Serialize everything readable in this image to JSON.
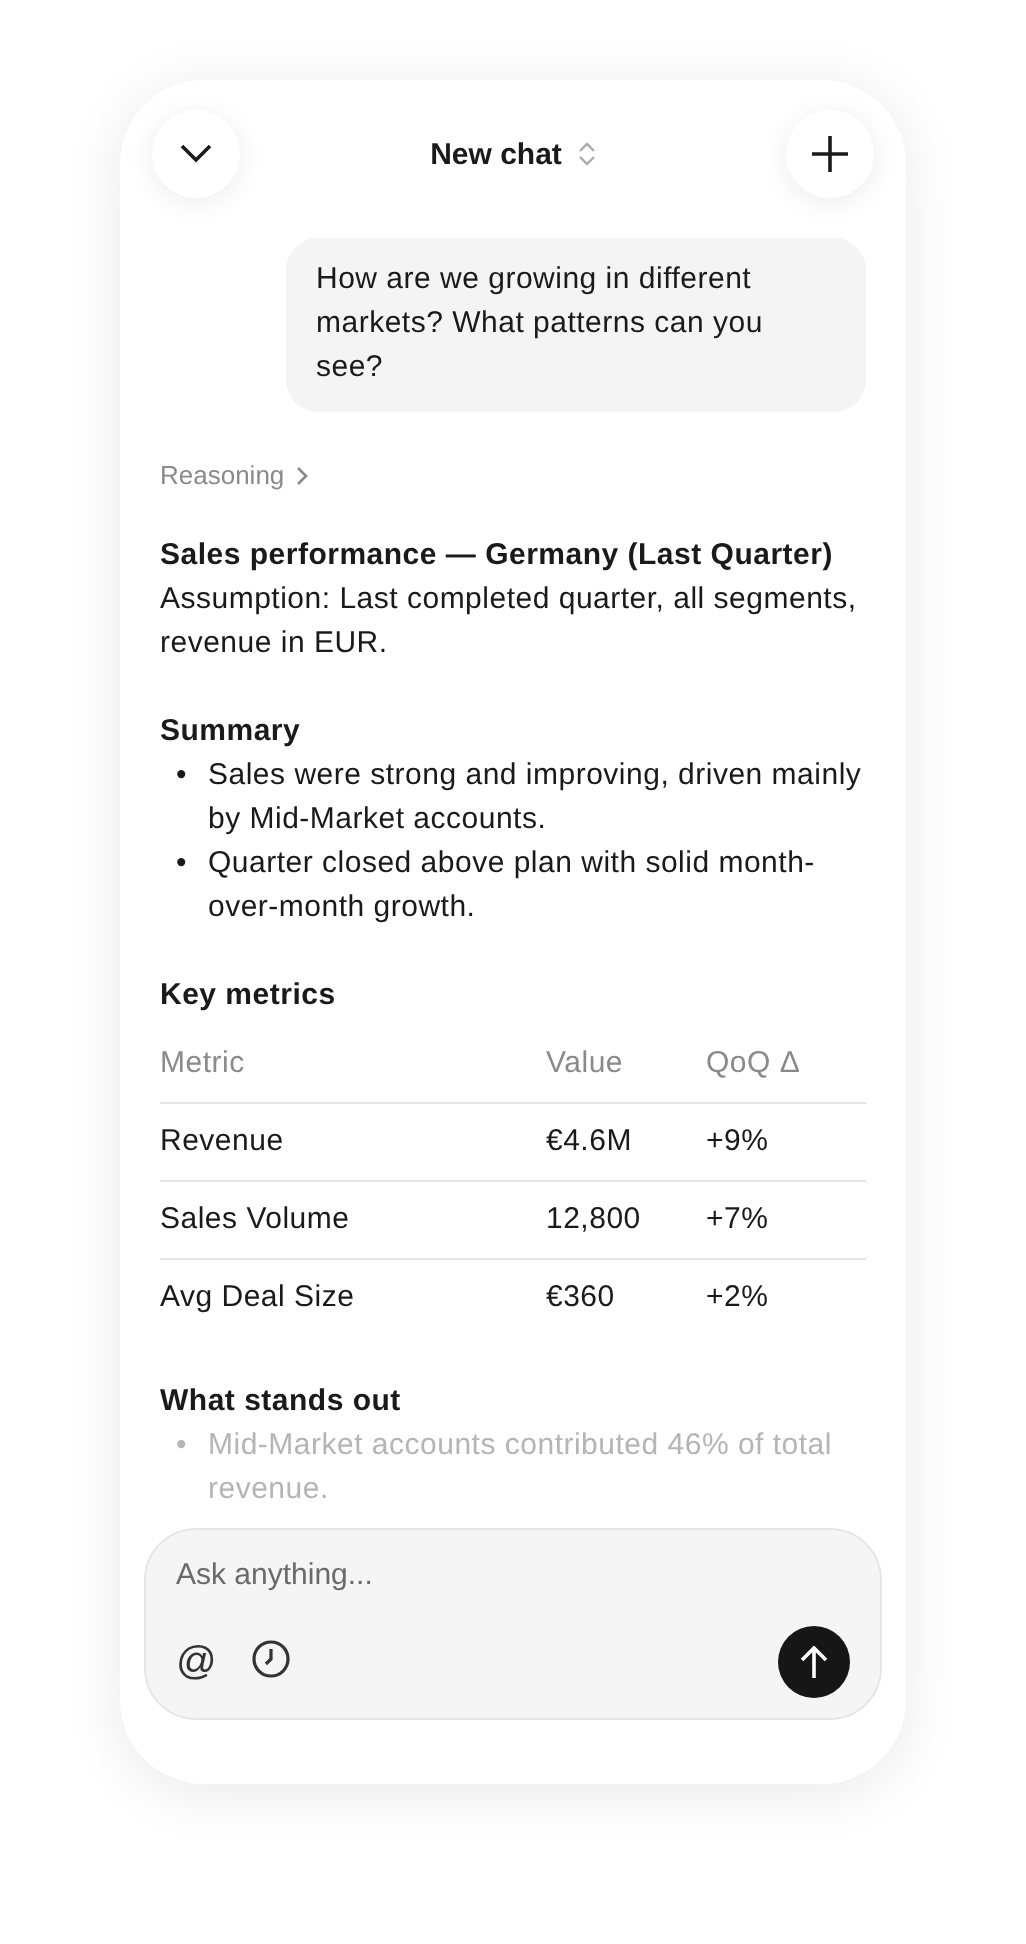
{
  "header": {
    "title": "New chat"
  },
  "user_message": "How are we growing in different markets? What patterns can you see?",
  "reasoning": {
    "label": "Reasoning",
    "expanded": false
  },
  "response": {
    "heading": "Sales performance — Germany (Last Quarter)",
    "assumption": "Assumption: Last completed quarter, all segments, revenue in EUR.",
    "summary": {
      "heading": "Summary",
      "marker": "•",
      "bullets": [
        "Sales were strong and improving, driven mainly by Mid-Market accounts.",
        "Quarter closed above plan with solid month-over-month growth."
      ]
    },
    "key_metrics": {
      "heading": "Key metrics",
      "columns": [
        "Metric",
        "Value",
        "QoQ Δ"
      ],
      "rows": [
        [
          "Revenue",
          "€4.6M",
          "+9%"
        ],
        [
          "Sales Volume",
          "12,800",
          "+7%"
        ],
        [
          "Avg Deal Size",
          "€360",
          "+2%"
        ]
      ]
    },
    "stands_out": {
      "heading": "What stands out",
      "marker": "•",
      "bullets": [
        "Mid-Market accounts contributed 46% of total revenue."
      ]
    }
  },
  "composer": {
    "placeholder": "Ask anything...",
    "mention": "@"
  }
}
